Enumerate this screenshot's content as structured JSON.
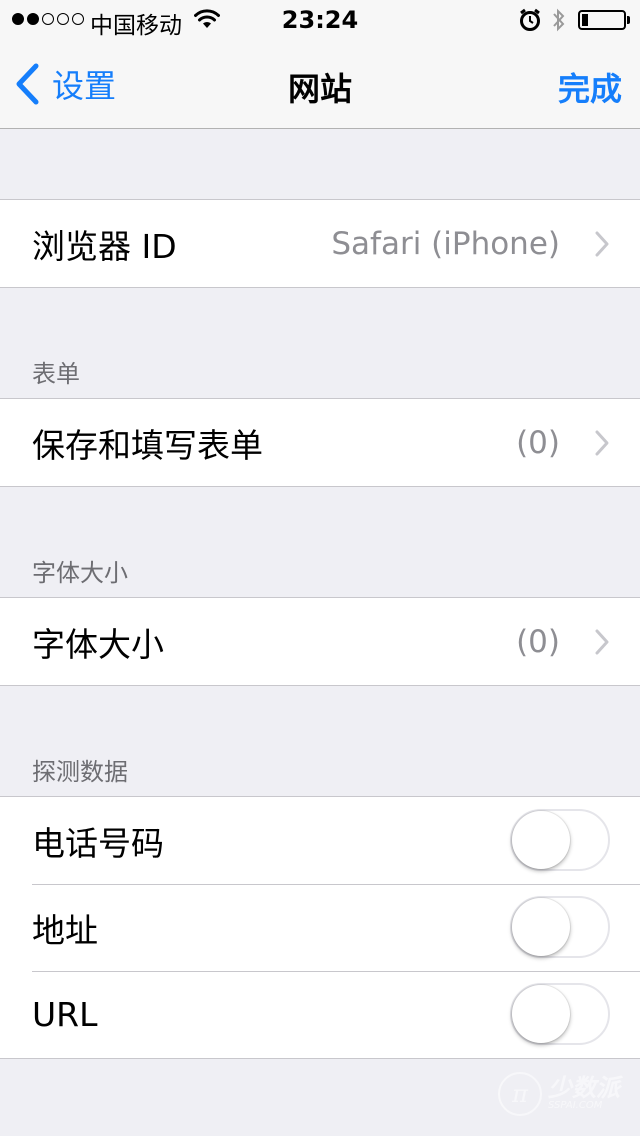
{
  "status_bar": {
    "carrier": "中国移动",
    "time": "23:24",
    "signal_strength": 2,
    "battery_level": 0.15
  },
  "nav": {
    "back_label": "设置",
    "title": "网站",
    "done_label": "完成"
  },
  "groups": {
    "browser": {
      "label": "浏览器 ID",
      "value": "Safari (iPhone)"
    },
    "forms": {
      "header": "表单",
      "label": "保存和填写表单",
      "value": "(0)"
    },
    "font_size": {
      "header": "字体大小",
      "label": "字体大小",
      "value": "(0)"
    },
    "detect": {
      "header": "探测数据",
      "items": [
        {
          "label": "电话号码",
          "on": false
        },
        {
          "label": "地址",
          "on": false
        },
        {
          "label": "URL",
          "on": false
        }
      ]
    }
  },
  "watermark": {
    "logo_text": "少数派",
    "logo_sub": "SSPAI.COM"
  },
  "colors": {
    "accent": "#157efb",
    "background": "#efeff4",
    "secondary_text": "#8e8e93"
  }
}
